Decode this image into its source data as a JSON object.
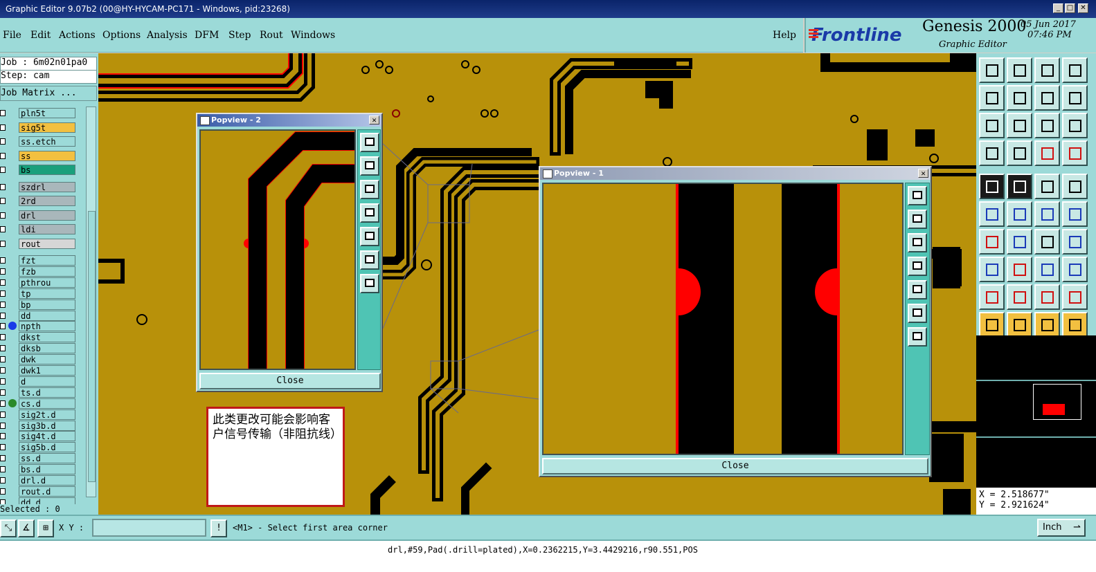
{
  "window": {
    "title": "Graphic Editor 9.07b2 (00@HY-HYCAM-PC171 - Windows, pid:23268)",
    "min_label": "_",
    "max_label": "□",
    "close_label": "✕"
  },
  "menu": {
    "items": [
      "File",
      "Edit",
      "Actions",
      "Options",
      "Analysis",
      "DFM",
      "Step",
      "Rout",
      "Windows"
    ],
    "help": "Help"
  },
  "brand": {
    "logo": "Frontline",
    "product": "Genesis 2000",
    "subtitle": "Graphic Editor",
    "date": "05 Jun 2017",
    "time": "07:46 PM"
  },
  "job": {
    "job_line": "Job : 6m02n01pa0",
    "step_line": "Step: cam",
    "matrix_button": "Job Matrix ..."
  },
  "layers": [
    {
      "name": "pln5t",
      "color": "#9cdad8"
    },
    {
      "name": "sig5t",
      "color": "#f2c040"
    },
    {
      "name": "ss.etch",
      "color": "#9cdad8"
    },
    {
      "name": "ss",
      "color": "#f2c040"
    },
    {
      "name": "bs",
      "color": "#19a07c"
    },
    {
      "name": "szdrl",
      "color": "#a9b7bb"
    },
    {
      "name": "2rd",
      "color": "#a9b7bb"
    },
    {
      "name": "drl",
      "color": "#a9b7bb"
    },
    {
      "name": "ldi",
      "color": "#a9b7bb"
    },
    {
      "name": "rout",
      "color": "#d6d6d6"
    },
    {
      "name": "fzt",
      "color": "#9cdad8"
    },
    {
      "name": "fzb",
      "color": "#9cdad8"
    },
    {
      "name": "pthrou",
      "color": "#9cdad8"
    },
    {
      "name": "tp",
      "color": "#9cdad8"
    },
    {
      "name": "bp",
      "color": "#9cdad8"
    },
    {
      "name": "dd",
      "color": "#9cdad8"
    },
    {
      "name": "npth",
      "color": "#9cdad8",
      "dot": "#1a3ae8"
    },
    {
      "name": "dkst",
      "color": "#9cdad8"
    },
    {
      "name": "dksb",
      "color": "#9cdad8"
    },
    {
      "name": "dwk",
      "color": "#9cdad8"
    },
    {
      "name": "dwk1",
      "color": "#9cdad8"
    },
    {
      "name": "d",
      "color": "#9cdad8"
    },
    {
      "name": "ts.d",
      "color": "#9cdad8"
    },
    {
      "name": "cs.d",
      "color": "#9cdad8",
      "dot": "#2a8a2a"
    },
    {
      "name": "sig2t.d",
      "color": "#9cdad8"
    },
    {
      "name": "sig3b.d",
      "color": "#9cdad8"
    },
    {
      "name": "sig4t.d",
      "color": "#9cdad8"
    },
    {
      "name": "sig5b.d",
      "color": "#9cdad8"
    },
    {
      "name": "ss.d",
      "color": "#9cdad8"
    },
    {
      "name": "bs.d",
      "color": "#9cdad8"
    },
    {
      "name": "drl.d",
      "color": "#9cdad8"
    },
    {
      "name": "rout.d",
      "color": "#9cdad8"
    },
    {
      "name": "dd.d",
      "color": "#9cdad8"
    }
  ],
  "selected_label": "Selected : 0",
  "popview2": {
    "title": "Popview - 2",
    "close": "Close"
  },
  "popview1": {
    "title": "Popview - 1",
    "close": "Close"
  },
  "note": "此类更改可能会影响客户信号传输（非阻抗线）",
  "coords": {
    "x": "X = 2.518677\"",
    "y": "Y = 2.921624\""
  },
  "bottom": {
    "xy_label": "X Y :",
    "xy_value": "",
    "warn": "!",
    "prompt": "<M1> - Select first area corner",
    "unit": "Inch"
  },
  "status": "drl,#59,Pad(.drill=plated),X=0.2362215,Y=3.4429216,r90.551,POS",
  "colors": {
    "board": "#b8910a",
    "copper": "#000000",
    "highlight": "#ff0000",
    "panel": "#9cdad8"
  }
}
